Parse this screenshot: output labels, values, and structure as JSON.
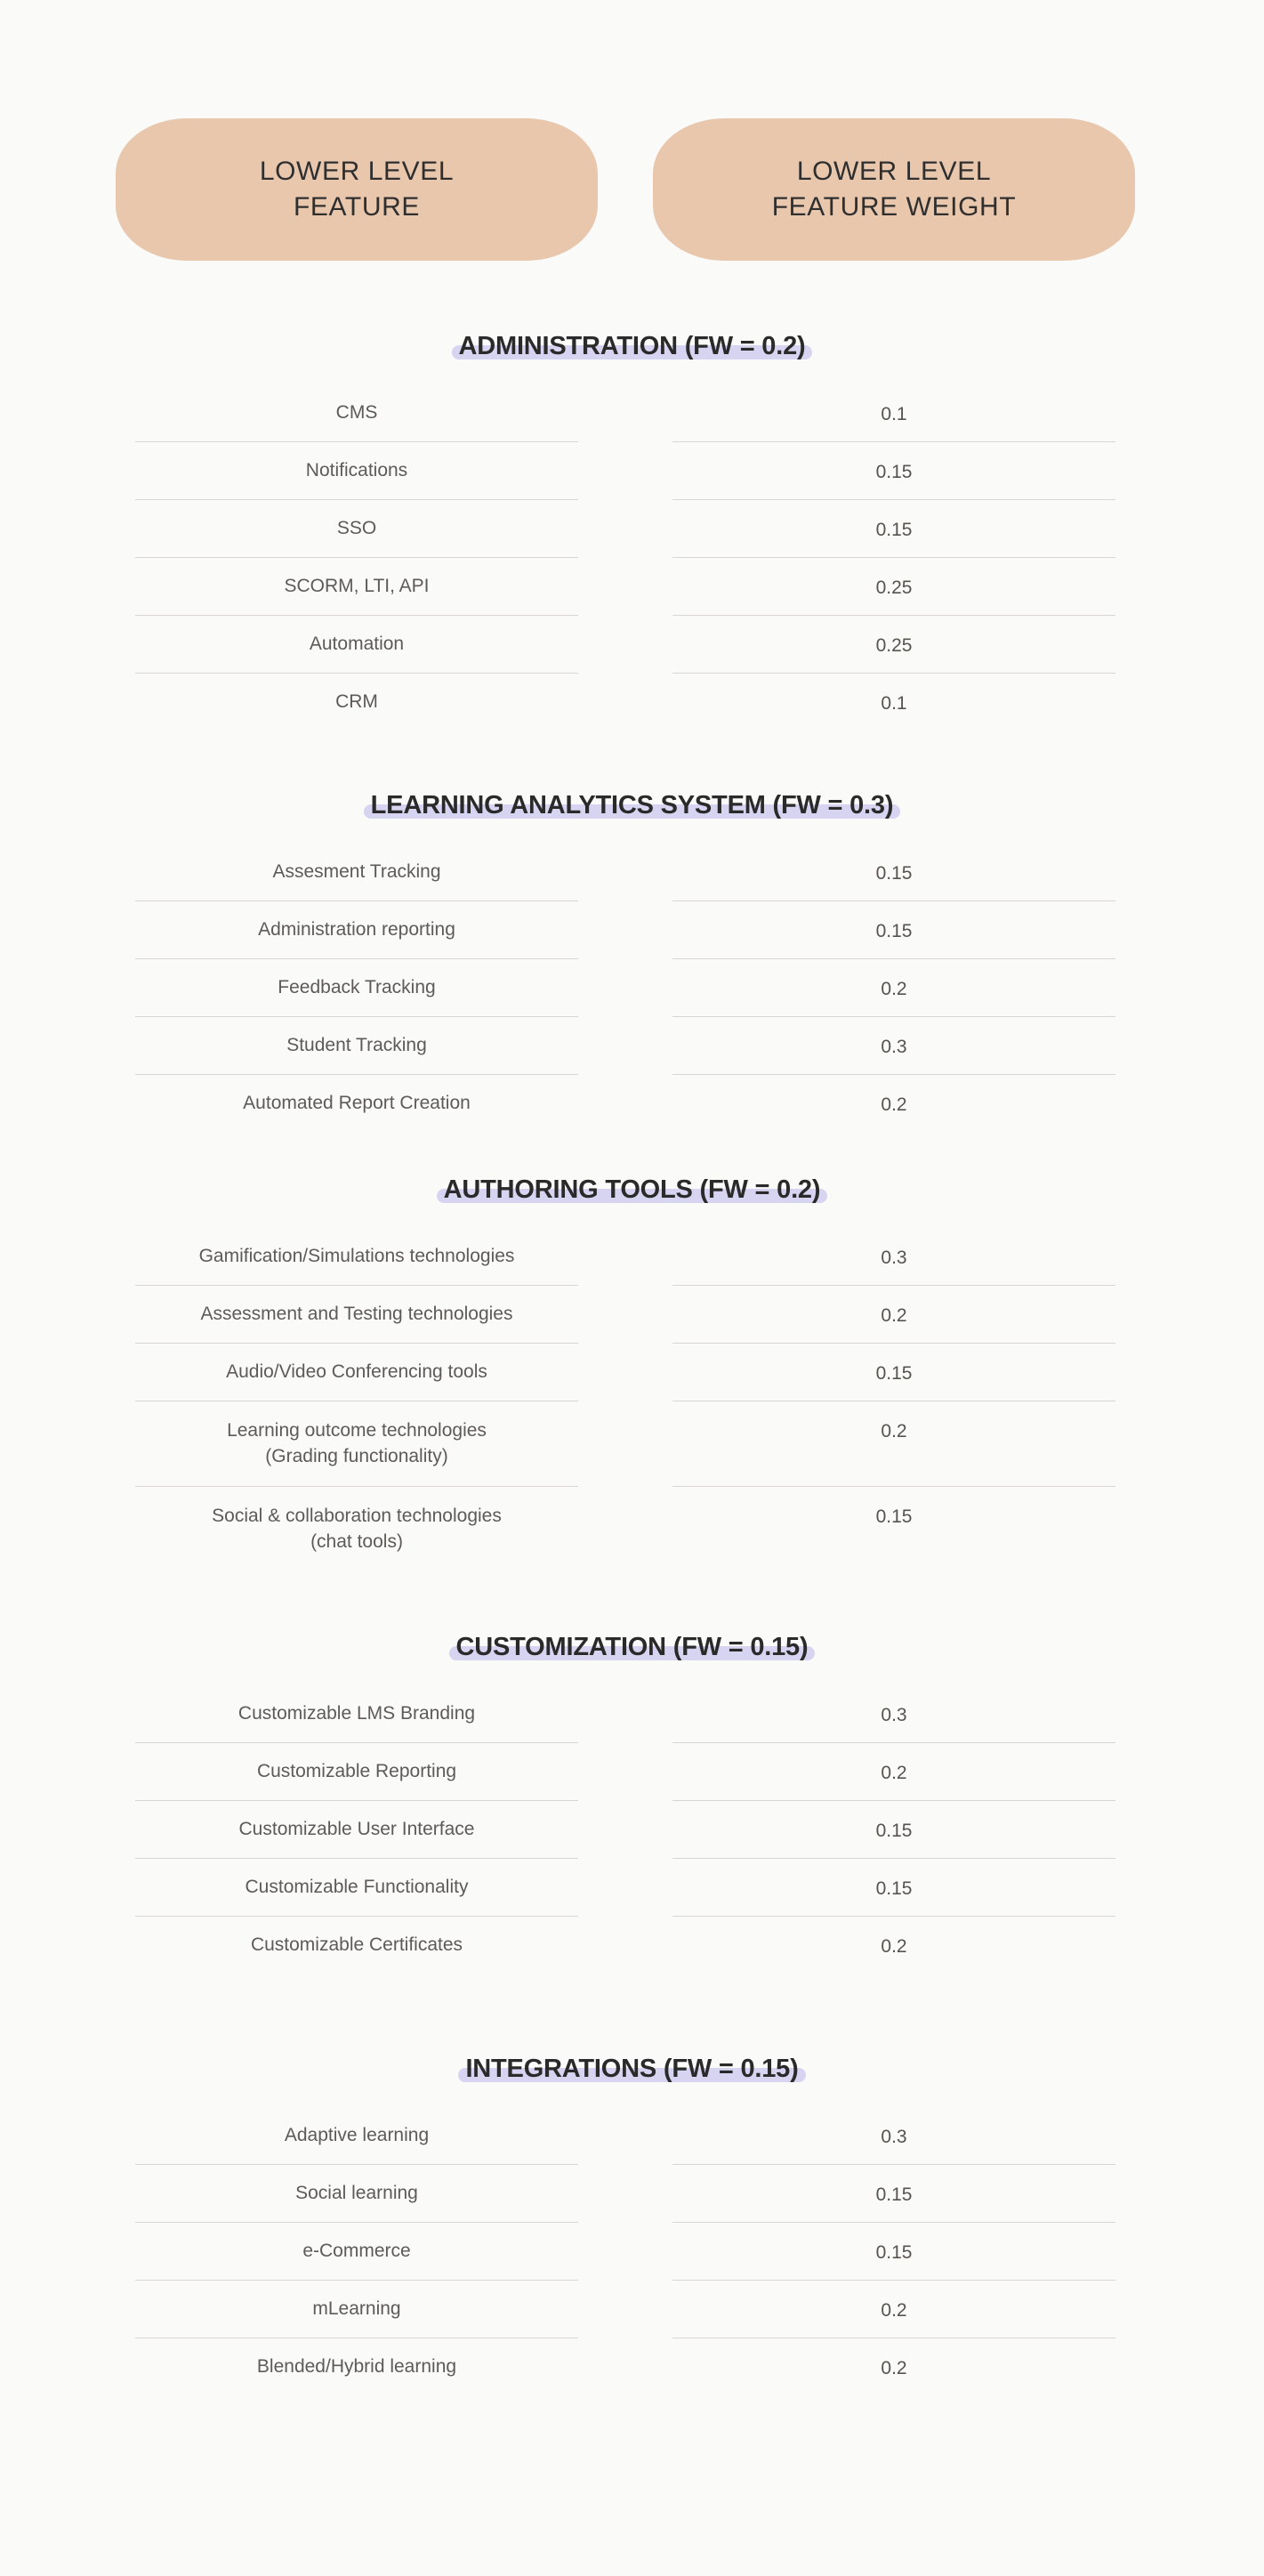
{
  "header": {
    "columns": [
      {
        "label": "LOWER LEVEL\nFEATURE",
        "name": "lower-level-feature"
      },
      {
        "label": "LOWER LEVEL\nFEATURE WEIGHT",
        "name": "lower-level-feature-weight"
      }
    ],
    "pill_color": "#E9C7AD"
  },
  "theme": {
    "background": "#FAFAF9",
    "highlight": "#D6D4F0",
    "rule": "#D8D5D2",
    "text": "#5E5A57",
    "heading_text": "#2A2A2A"
  },
  "chart_data": {
    "type": "table",
    "title": "Lower Level Feature Weights",
    "columns": [
      "LOWER LEVEL FEATURE",
      "LOWER LEVEL FEATURE WEIGHT"
    ],
    "sections": [
      {
        "heading": "ADMINISTRATION (FW = 0.2)",
        "name": "administration",
        "feature_weight": 0.2,
        "rows": [
          {
            "feature": "CMS",
            "weight": "0.1"
          },
          {
            "feature": "Notifications",
            "weight": "0.15"
          },
          {
            "feature": "SSO",
            "weight": "0.15"
          },
          {
            "feature": "SCORM, LTI, API",
            "weight": "0.25"
          },
          {
            "feature": "Automation",
            "weight": "0.25"
          },
          {
            "feature": "CRM",
            "weight": "0.1"
          }
        ]
      },
      {
        "heading": "LEARNING ANALYTICS SYSTEM (FW = 0.3)",
        "name": "learning-analytics-system",
        "feature_weight": 0.3,
        "rows": [
          {
            "feature": "Assesment Tracking",
            "weight": "0.15"
          },
          {
            "feature": "Administration reporting",
            "weight": "0.15"
          },
          {
            "feature": "Feedback Tracking",
            "weight": "0.2"
          },
          {
            "feature": "Student Tracking",
            "weight": "0.3"
          },
          {
            "feature": "Automated Report Creation",
            "weight": "0.2"
          }
        ]
      },
      {
        "heading": "AUTHORING TOOLS (FW = 0.2)",
        "name": "authoring-tools",
        "feature_weight": 0.2,
        "rows": [
          {
            "feature": "Gamification/Simulations technologies",
            "weight": "0.3"
          },
          {
            "feature": "Assessment and Testing technologies",
            "weight": "0.2"
          },
          {
            "feature": "Audio/Video Conferencing tools",
            "weight": "0.15"
          },
          {
            "feature": "Learning outcome technologies\n(Grading functionality)",
            "weight": "0.2",
            "tall": true
          },
          {
            "feature": "Social & collaboration technologies\n(chat tools)",
            "weight": "0.15",
            "tall": true
          }
        ]
      },
      {
        "heading": "CUSTOMIZATION (FW = 0.15)",
        "name": "customization",
        "feature_weight": 0.15,
        "rows": [
          {
            "feature": "Customizable LMS Branding",
            "weight": "0.3"
          },
          {
            "feature": "Customizable Reporting",
            "weight": "0.2"
          },
          {
            "feature": "Customizable User Interface",
            "weight": "0.15"
          },
          {
            "feature": "Customizable Functionality",
            "weight": "0.15"
          },
          {
            "feature": "Customizable Certificates",
            "weight": "0.2"
          }
        ]
      },
      {
        "heading": "INTEGRATIONS (FW = 0.15)",
        "name": "integrations",
        "feature_weight": 0.15,
        "rows": [
          {
            "feature": "Adaptive learning",
            "weight": "0.3"
          },
          {
            "feature": "Social learning",
            "weight": "0.15"
          },
          {
            "feature": "e-Commerce",
            "weight": "0.15"
          },
          {
            "feature": "mLearning",
            "weight": "0.2"
          },
          {
            "feature": "Blended/Hybrid learning",
            "weight": "0.2"
          }
        ]
      }
    ]
  }
}
